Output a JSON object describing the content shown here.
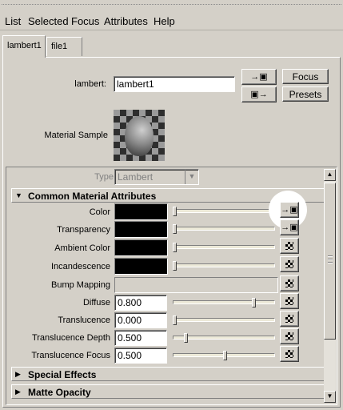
{
  "menu": [
    "List",
    "Selected",
    "Focus",
    "Attributes",
    "Help"
  ],
  "tabs": [
    "lambert1",
    "file1"
  ],
  "node": {
    "label": "lambert:",
    "value": "lambert1",
    "focus_label": "Focus",
    "presets_label": "Presets",
    "material_sample_label": "Material Sample"
  },
  "type": {
    "label": "Type",
    "value": "Lambert"
  },
  "sections": {
    "common": "Common Material Attributes",
    "special": "Special Effects",
    "matte": "Matte Opacity"
  },
  "attributes": {
    "color": {
      "label": "Color"
    },
    "transparency": {
      "label": "Transparency"
    },
    "ambient": {
      "label": "Ambient Color"
    },
    "incandescence": {
      "label": "Incandescence"
    },
    "bump": {
      "label": "Bump Mapping"
    },
    "diffuse": {
      "label": "Diffuse",
      "value": "0.800"
    },
    "translucence": {
      "label": "Translucence",
      "value": "0.000"
    },
    "translucence_depth": {
      "label": "Translucence Depth",
      "value": "0.500"
    },
    "translucence_focus": {
      "label": "Translucence Focus",
      "value": "0.500"
    }
  },
  "icons": {
    "input_connection": "arrow-into-box-icon",
    "output_connection": "arrow-out-box-icon",
    "map_button": "checker-map-icon"
  }
}
